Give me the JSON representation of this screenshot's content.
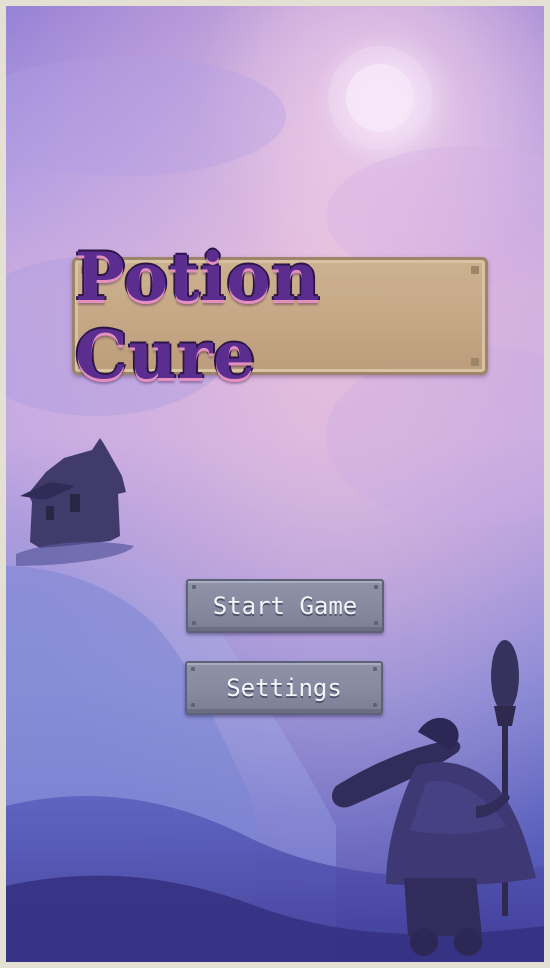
{
  "game": {
    "title": "Potion Cure"
  },
  "menu": {
    "start_label": "Start Game",
    "settings_label": "Settings"
  },
  "colors": {
    "title_text": "#5a2d8f",
    "title_highlight": "#e48fbf",
    "plate": "#c6a886",
    "button": "#868aa0",
    "button_text": "#f4f4f8"
  },
  "icons": {
    "tower": "tower-silhouette-icon",
    "witch": "witch-with-broom-icon",
    "moon": "moon-glow-icon"
  }
}
